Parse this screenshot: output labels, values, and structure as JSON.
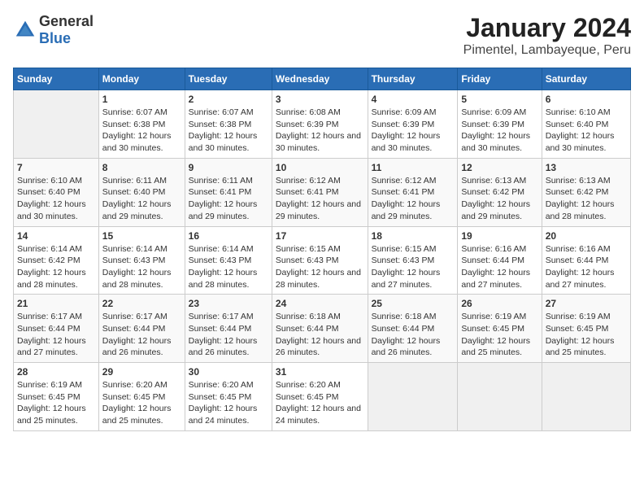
{
  "logo": {
    "general": "General",
    "blue": "Blue"
  },
  "title": "January 2024",
  "subtitle": "Pimentel, Lambayeque, Peru",
  "headers": [
    "Sunday",
    "Monday",
    "Tuesday",
    "Wednesday",
    "Thursday",
    "Friday",
    "Saturday"
  ],
  "weeks": [
    [
      {
        "day": "",
        "sunrise": "",
        "sunset": "",
        "daylight": ""
      },
      {
        "day": "1",
        "sunrise": "Sunrise: 6:07 AM",
        "sunset": "Sunset: 6:38 PM",
        "daylight": "Daylight: 12 hours and 30 minutes."
      },
      {
        "day": "2",
        "sunrise": "Sunrise: 6:07 AM",
        "sunset": "Sunset: 6:38 PM",
        "daylight": "Daylight: 12 hours and 30 minutes."
      },
      {
        "day": "3",
        "sunrise": "Sunrise: 6:08 AM",
        "sunset": "Sunset: 6:39 PM",
        "daylight": "Daylight: 12 hours and 30 minutes."
      },
      {
        "day": "4",
        "sunrise": "Sunrise: 6:09 AM",
        "sunset": "Sunset: 6:39 PM",
        "daylight": "Daylight: 12 hours and 30 minutes."
      },
      {
        "day": "5",
        "sunrise": "Sunrise: 6:09 AM",
        "sunset": "Sunset: 6:39 PM",
        "daylight": "Daylight: 12 hours and 30 minutes."
      },
      {
        "day": "6",
        "sunrise": "Sunrise: 6:10 AM",
        "sunset": "Sunset: 6:40 PM",
        "daylight": "Daylight: 12 hours and 30 minutes."
      }
    ],
    [
      {
        "day": "7",
        "sunrise": "Sunrise: 6:10 AM",
        "sunset": "Sunset: 6:40 PM",
        "daylight": "Daylight: 12 hours and 30 minutes."
      },
      {
        "day": "8",
        "sunrise": "Sunrise: 6:11 AM",
        "sunset": "Sunset: 6:40 PM",
        "daylight": "Daylight: 12 hours and 29 minutes."
      },
      {
        "day": "9",
        "sunrise": "Sunrise: 6:11 AM",
        "sunset": "Sunset: 6:41 PM",
        "daylight": "Daylight: 12 hours and 29 minutes."
      },
      {
        "day": "10",
        "sunrise": "Sunrise: 6:12 AM",
        "sunset": "Sunset: 6:41 PM",
        "daylight": "Daylight: 12 hours and 29 minutes."
      },
      {
        "day": "11",
        "sunrise": "Sunrise: 6:12 AM",
        "sunset": "Sunset: 6:41 PM",
        "daylight": "Daylight: 12 hours and 29 minutes."
      },
      {
        "day": "12",
        "sunrise": "Sunrise: 6:13 AM",
        "sunset": "Sunset: 6:42 PM",
        "daylight": "Daylight: 12 hours and 29 minutes."
      },
      {
        "day": "13",
        "sunrise": "Sunrise: 6:13 AM",
        "sunset": "Sunset: 6:42 PM",
        "daylight": "Daylight: 12 hours and 28 minutes."
      }
    ],
    [
      {
        "day": "14",
        "sunrise": "Sunrise: 6:14 AM",
        "sunset": "Sunset: 6:42 PM",
        "daylight": "Daylight: 12 hours and 28 minutes."
      },
      {
        "day": "15",
        "sunrise": "Sunrise: 6:14 AM",
        "sunset": "Sunset: 6:43 PM",
        "daylight": "Daylight: 12 hours and 28 minutes."
      },
      {
        "day": "16",
        "sunrise": "Sunrise: 6:14 AM",
        "sunset": "Sunset: 6:43 PM",
        "daylight": "Daylight: 12 hours and 28 minutes."
      },
      {
        "day": "17",
        "sunrise": "Sunrise: 6:15 AM",
        "sunset": "Sunset: 6:43 PM",
        "daylight": "Daylight: 12 hours and 28 minutes."
      },
      {
        "day": "18",
        "sunrise": "Sunrise: 6:15 AM",
        "sunset": "Sunset: 6:43 PM",
        "daylight": "Daylight: 12 hours and 27 minutes."
      },
      {
        "day": "19",
        "sunrise": "Sunrise: 6:16 AM",
        "sunset": "Sunset: 6:44 PM",
        "daylight": "Daylight: 12 hours and 27 minutes."
      },
      {
        "day": "20",
        "sunrise": "Sunrise: 6:16 AM",
        "sunset": "Sunset: 6:44 PM",
        "daylight": "Daylight: 12 hours and 27 minutes."
      }
    ],
    [
      {
        "day": "21",
        "sunrise": "Sunrise: 6:17 AM",
        "sunset": "Sunset: 6:44 PM",
        "daylight": "Daylight: 12 hours and 27 minutes."
      },
      {
        "day": "22",
        "sunrise": "Sunrise: 6:17 AM",
        "sunset": "Sunset: 6:44 PM",
        "daylight": "Daylight: 12 hours and 26 minutes."
      },
      {
        "day": "23",
        "sunrise": "Sunrise: 6:17 AM",
        "sunset": "Sunset: 6:44 PM",
        "daylight": "Daylight: 12 hours and 26 minutes."
      },
      {
        "day": "24",
        "sunrise": "Sunrise: 6:18 AM",
        "sunset": "Sunset: 6:44 PM",
        "daylight": "Daylight: 12 hours and 26 minutes."
      },
      {
        "day": "25",
        "sunrise": "Sunrise: 6:18 AM",
        "sunset": "Sunset: 6:44 PM",
        "daylight": "Daylight: 12 hours and 26 minutes."
      },
      {
        "day": "26",
        "sunrise": "Sunrise: 6:19 AM",
        "sunset": "Sunset: 6:45 PM",
        "daylight": "Daylight: 12 hours and 25 minutes."
      },
      {
        "day": "27",
        "sunrise": "Sunrise: 6:19 AM",
        "sunset": "Sunset: 6:45 PM",
        "daylight": "Daylight: 12 hours and 25 minutes."
      }
    ],
    [
      {
        "day": "28",
        "sunrise": "Sunrise: 6:19 AM",
        "sunset": "Sunset: 6:45 PM",
        "daylight": "Daylight: 12 hours and 25 minutes."
      },
      {
        "day": "29",
        "sunrise": "Sunrise: 6:20 AM",
        "sunset": "Sunset: 6:45 PM",
        "daylight": "Daylight: 12 hours and 25 minutes."
      },
      {
        "day": "30",
        "sunrise": "Sunrise: 6:20 AM",
        "sunset": "Sunset: 6:45 PM",
        "daylight": "Daylight: 12 hours and 24 minutes."
      },
      {
        "day": "31",
        "sunrise": "Sunrise: 6:20 AM",
        "sunset": "Sunset: 6:45 PM",
        "daylight": "Daylight: 12 hours and 24 minutes."
      },
      {
        "day": "",
        "sunrise": "",
        "sunset": "",
        "daylight": ""
      },
      {
        "day": "",
        "sunrise": "",
        "sunset": "",
        "daylight": ""
      },
      {
        "day": "",
        "sunrise": "",
        "sunset": "",
        "daylight": ""
      }
    ]
  ]
}
